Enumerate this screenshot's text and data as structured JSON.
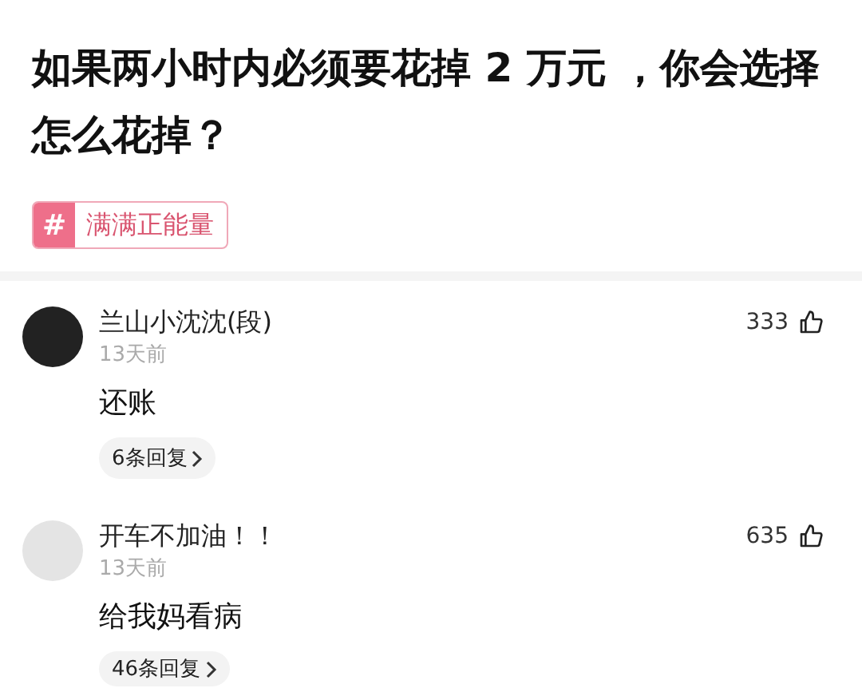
{
  "question": {
    "title": "如果两小时内必须要花掉 2 万元 ，你会选择怎么花掉？",
    "tag": {
      "symbol": "#",
      "label": "满满正能量"
    }
  },
  "comments": [
    {
      "user": "兰山小沈沈(段)",
      "color": "#222222",
      "time": "13天前",
      "text": "还账",
      "likes": "333",
      "replies": "6条回复"
    },
    {
      "user": "开车不加油！！",
      "color": "#e4e4e4",
      "time": "13天前",
      "text": "给我妈看病",
      "likes": "635",
      "replies": "46条回复"
    }
  ]
}
